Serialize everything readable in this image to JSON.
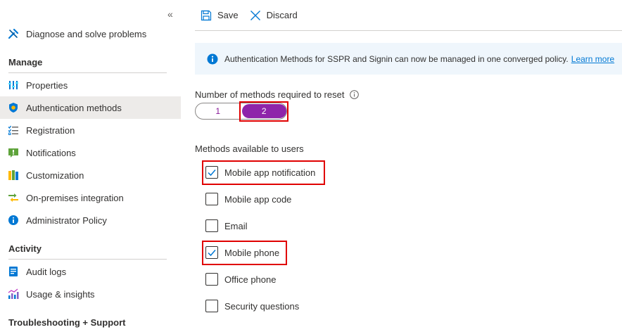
{
  "sidebar": {
    "top_item": {
      "label": "Diagnose and solve problems",
      "icon": "wrench-icon"
    },
    "sections": {
      "manage": "Manage",
      "activity": "Activity",
      "troubleshooting": "Troubleshooting + Support"
    },
    "manage_items": [
      {
        "label": "Properties",
        "icon": "properties-icon"
      },
      {
        "label": "Authentication methods",
        "icon": "shield-icon",
        "active": true
      },
      {
        "label": "Registration",
        "icon": "checklist-icon"
      },
      {
        "label": "Notifications",
        "icon": "notification-icon"
      },
      {
        "label": "Customization",
        "icon": "customization-icon"
      },
      {
        "label": "On-premises integration",
        "icon": "sync-icon"
      },
      {
        "label": "Administrator Policy",
        "icon": "info-icon"
      }
    ],
    "activity_items": [
      {
        "label": "Audit logs",
        "icon": "audit-log-icon"
      },
      {
        "label": "Usage & insights",
        "icon": "insights-icon"
      }
    ]
  },
  "toolbar": {
    "save_label": "Save",
    "discard_label": "Discard"
  },
  "banner": {
    "text": "Authentication Methods for SSPR and Signin can now be managed in one converged policy.",
    "link": "Learn more"
  },
  "methods_required": {
    "label": "Number of methods required to reset",
    "options": [
      "1",
      "2"
    ],
    "selected": "2"
  },
  "methods_available": {
    "label": "Methods available to users",
    "items": [
      {
        "label": "Mobile app notification",
        "checked": true
      },
      {
        "label": "Mobile app code",
        "checked": false
      },
      {
        "label": "Email",
        "checked": false
      },
      {
        "label": "Mobile phone",
        "checked": true
      },
      {
        "label": "Office phone",
        "checked": false
      },
      {
        "label": "Security questions",
        "checked": false
      }
    ]
  },
  "colors": {
    "accent": "#0078d4",
    "toggle_selected": "#8e24aa",
    "highlight": "#e00000",
    "active_nav": "#edebe9"
  }
}
